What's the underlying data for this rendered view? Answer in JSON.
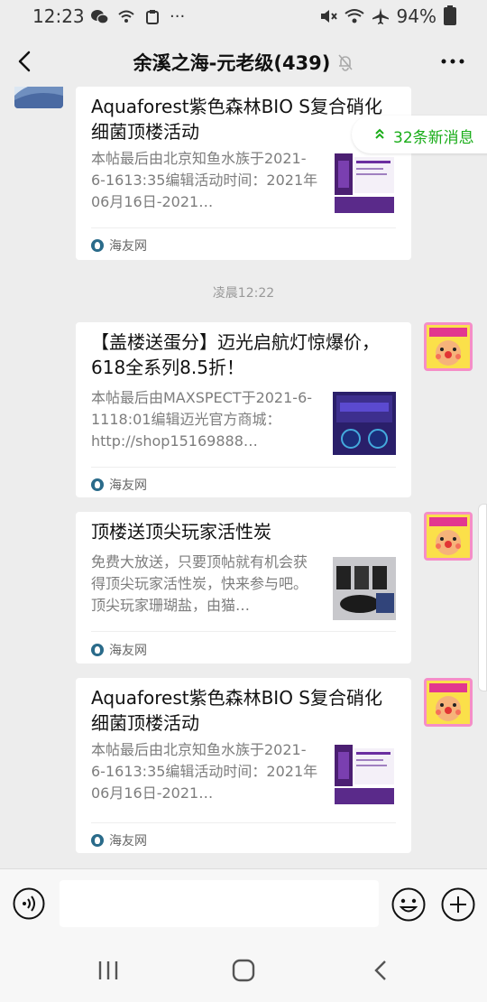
{
  "status_bar": {
    "time": "12:23",
    "battery": "94%",
    "dots": "···"
  },
  "header": {
    "title": "余溪之海-元老级(439)"
  },
  "new_messages_pill": "32条新消息",
  "messages": [
    {
      "title": "Aquaforest紫色森林BIO S复合硝化细菌顶楼活动",
      "desc": "本帖最后由北京知鱼水族于2021-6-1613:35编辑活动时间：2021年06月16日-2021…",
      "source": "海友网"
    },
    {
      "timestamp": "凌晨12:22"
    },
    {
      "title": "【盖楼送蛋分】迈光启航灯惊爆价，618全系列8.5折！",
      "desc": "本帖最后由MAXSPECT于2021-6-1118:01编辑迈光官方商城：http://shop15169888…",
      "source": "海友网"
    },
    {
      "title": "顶楼送顶尖玩家活性炭",
      "desc": "免费大放送，只要顶帖就有机会获得顶尖玩家活性炭，快来参与吧。顶尖玩家珊瑚盐，由猫…",
      "source": "海友网"
    },
    {
      "title": "Aquaforest紫色森林BIO S复合硝化细菌顶楼活动",
      "desc": "本帖最后由北京知鱼水族于2021-6-1613:35编辑活动时间：2021年06月16日-2021…",
      "source": "海友网"
    }
  ],
  "icons": {
    "back": "chevron-left-icon",
    "more": "more-horizontal-icon",
    "mute": "bell-off-icon",
    "voice": "voice-icon",
    "emoji": "emoji-icon",
    "plus": "plus-circle-icon"
  },
  "colors": {
    "accent_green": "#1aad19",
    "background": "#ededed"
  }
}
